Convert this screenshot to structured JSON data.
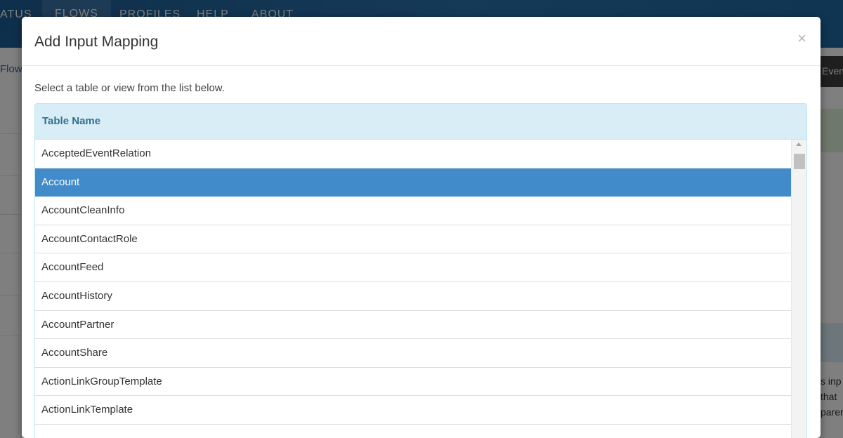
{
  "background": {
    "nav_items": [
      "ATUS",
      "FLOWS",
      "PROFILES",
      "HELP",
      "ABOUT"
    ],
    "breadcrumb": "Flow",
    "right_tab": "Event",
    "right_text": [
      "s inp",
      "that",
      "parer"
    ]
  },
  "modal": {
    "title": "Add Input Mapping",
    "close_label": "×",
    "instruction": "Select a table or view from the list below.",
    "table": {
      "header": "Table Name",
      "selected_index": 1,
      "rows": [
        "AcceptedEventRelation",
        "Account",
        "AccountCleanInfo",
        "AccountContactRole",
        "AccountFeed",
        "AccountHistory",
        "AccountPartner",
        "AccountShare",
        "ActionLinkGroupTemplate",
        "ActionLinkTemplate"
      ]
    }
  }
}
